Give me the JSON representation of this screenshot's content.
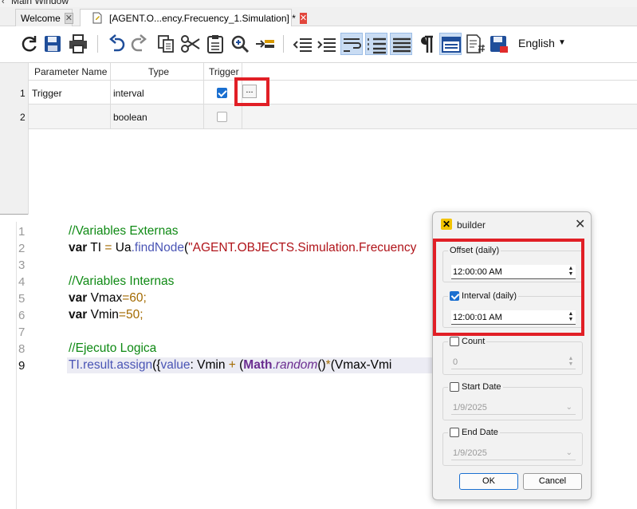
{
  "window": {
    "title": "Main Window"
  },
  "tabs": [
    {
      "label": "Welcome"
    },
    {
      "label": "[AGENT.O...ency.Frecuency_1.Simulation] *"
    }
  ],
  "toolbar": {
    "icons": [
      "refresh-icon",
      "save-icon",
      "print-icon",
      "undo-icon",
      "redo-icon",
      "copy-icon",
      "cut-icon",
      "paste-icon",
      "find-icon",
      "insert-line-icon",
      "outdent-icon",
      "indent-icon",
      "wrap-icon",
      "numbered-list-icon",
      "justify-icon",
      "pilcrow-icon",
      "layout-icon",
      "code-file-icon",
      "save-as-icon"
    ],
    "language": "English"
  },
  "grid": {
    "columns": [
      "Parameter Name",
      "Type",
      "Trigger"
    ],
    "rows": [
      {
        "num": "1",
        "name": "Trigger",
        "type": "interval",
        "trigger": true,
        "button": "..."
      },
      {
        "num": "2",
        "name": "",
        "type": "boolean",
        "trigger": false
      }
    ]
  },
  "editor": {
    "line_numbers": [
      "1",
      "2",
      "3",
      "4",
      "5",
      "6",
      "7",
      "8",
      "9"
    ],
    "lines": {
      "l1_comment": "//Variables Externas",
      "l2_kw": "var",
      "l2_var": " TI ",
      "l2_eq": "=",
      "l2_ua": " Ua",
      "l2_dot": ".",
      "l2_fn": "findNode",
      "l2_paren": "(",
      "l2_str": "\"AGENT.OBJECTS.Simulation.Frecuency",
      "l4_comment": "//Variables Internas",
      "l5_kw": "var",
      "l5_var": " Vmax",
      "l5_eq": "=",
      "l5_num": "60",
      "l5_semi": ";",
      "l6_kw": "var",
      "l6_var": " Vmin",
      "l6_eq": "=",
      "l6_num": "50",
      "l6_semi": ";",
      "l8_comment": "//Ejecuto Logica",
      "l9_a": "TI",
      "l9_b": ".",
      "l9_c": "result",
      "l9_d": ".",
      "l9_e": "assign",
      "l9_f": "({",
      "l9_g": "value",
      "l9_h": ": Vmin ",
      "l9_i": "+",
      "l9_j": " (",
      "l9_k": "Math",
      "l9_l": ".",
      "l9_m": "random",
      "l9_n": "()",
      "l9_o": "*",
      "l9_p": "(Vmax-Vmi"
    }
  },
  "dialog": {
    "title": "builder",
    "offset": {
      "label": "Offset (daily)",
      "value": "12:00:00 AM"
    },
    "interval": {
      "label": "Interval (daily)",
      "value": "12:00:01 AM",
      "checked": true
    },
    "count": {
      "label": "Count",
      "value": "0",
      "checked": false
    },
    "start_date": {
      "label": "Start Date",
      "value": "1/9/2025",
      "checked": false
    },
    "end_date": {
      "label": "End Date",
      "value": "1/9/2025",
      "checked": false
    },
    "ok": "OK",
    "cancel": "Cancel"
  },
  "colors": {
    "highlight": "#e11f26",
    "accent": "#1a6fd0"
  }
}
